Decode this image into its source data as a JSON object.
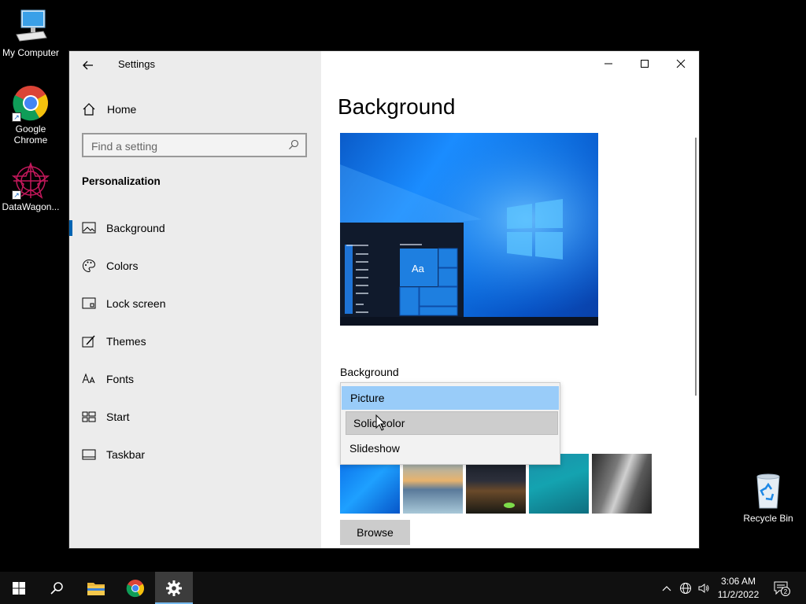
{
  "desktop": {
    "icons": [
      {
        "label": "My Computer",
        "icon": "computer-icon"
      },
      {
        "label": "Google\nChrome",
        "icon": "chrome-icon"
      },
      {
        "label": "DataWagon...",
        "icon": "datawagon-icon"
      }
    ],
    "recycle_bin": {
      "label": "Recycle Bin",
      "icon": "recycle-bin-icon"
    }
  },
  "window": {
    "title": "Settings",
    "sidebar": {
      "home_label": "Home",
      "search_placeholder": "Find a setting",
      "section": "Personalization",
      "items": [
        {
          "label": "Background",
          "icon": "picture-icon",
          "selected": true
        },
        {
          "label": "Colors",
          "icon": "palette-icon",
          "selected": false
        },
        {
          "label": "Lock screen",
          "icon": "lock-screen-icon",
          "selected": false
        },
        {
          "label": "Themes",
          "icon": "themes-icon",
          "selected": false
        },
        {
          "label": "Fonts",
          "icon": "fonts-icon",
          "selected": false
        },
        {
          "label": "Start",
          "icon": "start-icon",
          "selected": false
        },
        {
          "label": "Taskbar",
          "icon": "taskbar-icon",
          "selected": false
        }
      ]
    },
    "main": {
      "title": "Background",
      "preview_tile_text": "Aa",
      "background_label": "Background",
      "dropdown_options": [
        "Picture",
        "Solid color",
        "Slideshow"
      ],
      "dropdown_selected": "Picture",
      "dropdown_hover": "Solid color",
      "browse_label": "Browse"
    }
  },
  "taskbar": {
    "pinned": [
      "start-icon",
      "search-icon",
      "file-explorer-icon",
      "chrome-icon",
      "settings-icon"
    ],
    "active": "settings-icon",
    "clock_time": "3:06 AM",
    "clock_date": "11/2/2022",
    "notification_count": "2"
  },
  "colors": {
    "accent": "#0063b1",
    "selected_option": "#99ccf9",
    "taskbar": "#101010",
    "sidebar": "#ececec"
  }
}
